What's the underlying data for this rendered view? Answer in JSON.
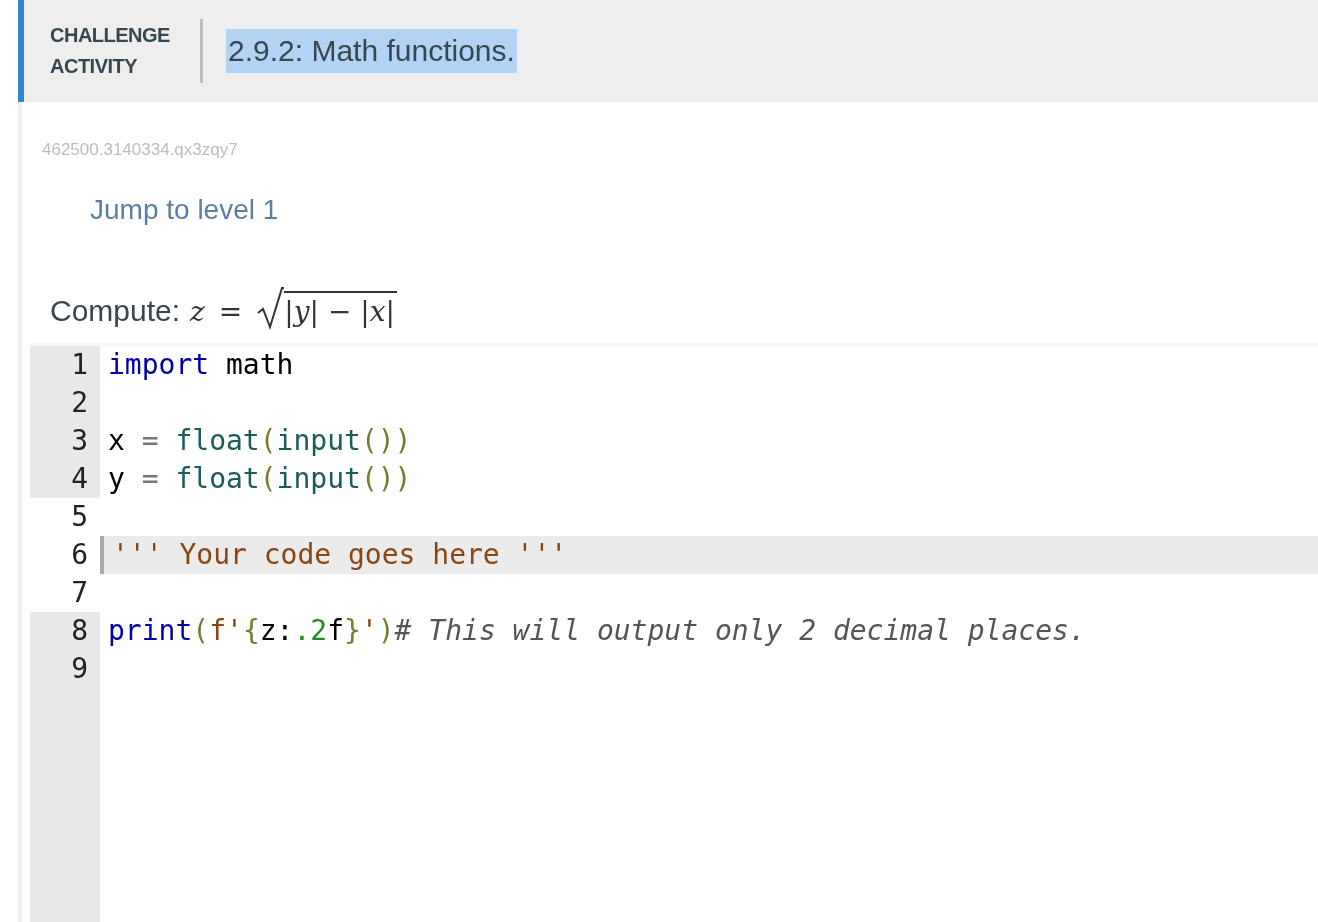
{
  "header": {
    "label": "CHALLENGE ACTIVITY",
    "title": "2.9.2: Math functions.",
    "title_selected": true
  },
  "activity_id": "462500.3140334.qx3zqy7",
  "jump_link": "Jump to level 1",
  "prompt": {
    "label": "Compute:",
    "lhs": "z",
    "relation": "=",
    "radicand": "|y| − |x|"
  },
  "editor": {
    "lines": [
      {
        "number": "1",
        "editable": false,
        "active": false,
        "tokens": [
          {
            "kind": "keyword",
            "text": "import"
          },
          {
            "kind": "plain",
            "text": " math"
          }
        ]
      },
      {
        "number": "2",
        "editable": false,
        "active": false
      },
      {
        "number": "3",
        "editable": false,
        "active": false,
        "tokens": [
          {
            "kind": "plain",
            "text": "x "
          },
          {
            "kind": "operator",
            "text": "="
          },
          {
            "kind": "builtin",
            "text": " float"
          },
          {
            "kind": "bracket",
            "text": "("
          },
          {
            "kind": "builtin",
            "text": "input"
          },
          {
            "kind": "bracket",
            "text": "())"
          }
        ]
      },
      {
        "number": "4",
        "editable": false,
        "active": false,
        "tokens": [
          {
            "kind": "plain",
            "text": "y "
          },
          {
            "kind": "operator",
            "text": "="
          },
          {
            "kind": "builtin",
            "text": " float"
          },
          {
            "kind": "bracket",
            "text": "("
          },
          {
            "kind": "builtin",
            "text": "input"
          },
          {
            "kind": "bracket",
            "text": "())"
          }
        ]
      },
      {
        "number": "5",
        "editable": true,
        "active": false
      },
      {
        "number": "6",
        "editable": true,
        "active": true,
        "tokens": [
          {
            "kind": "string",
            "text": "''' Your code goes here '''"
          }
        ]
      },
      {
        "number": "7",
        "editable": true,
        "active": false
      },
      {
        "number": "8",
        "editable": false,
        "active": false,
        "tokens": [
          {
            "kind": "keyword",
            "text": "print"
          },
          {
            "kind": "bracket",
            "text": "("
          },
          {
            "kind": "string",
            "text": "f'"
          },
          {
            "kind": "bracket",
            "text": "{"
          },
          {
            "kind": "plain",
            "text": "z:"
          },
          {
            "kind": "number",
            "text": ".2"
          },
          {
            "kind": "plain",
            "text": "f"
          },
          {
            "kind": "bracket",
            "text": "}"
          },
          {
            "kind": "string",
            "text": "'"
          },
          {
            "kind": "bracket",
            "text": ")"
          },
          {
            "kind": "comment",
            "text": "# This will output only 2 decimal places."
          }
        ]
      },
      {
        "number": "9",
        "editable": false,
        "active": false
      }
    ]
  }
}
